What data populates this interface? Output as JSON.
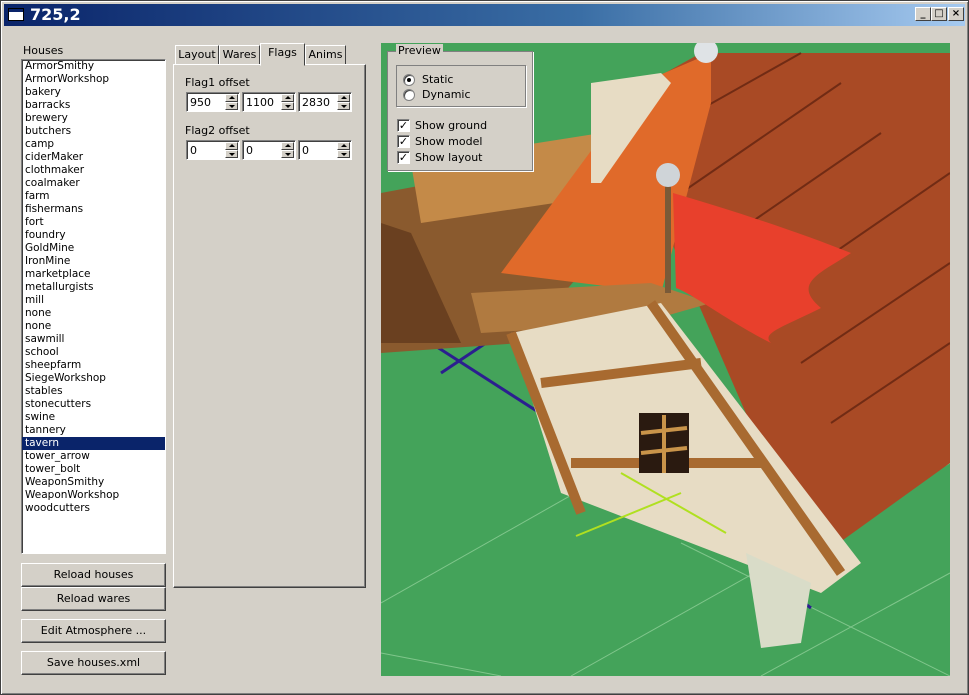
{
  "window": {
    "title": "725,2"
  },
  "houses": {
    "label": "Houses",
    "items": [
      "ArmorSmithy",
      "ArmorWorkshop",
      "bakery",
      "barracks",
      "brewery",
      "butchers",
      "camp",
      "ciderMaker",
      "clothmaker",
      "coalmaker",
      "farm",
      "fishermans",
      "fort",
      "foundry",
      "GoldMine",
      "IronMine",
      "marketplace",
      "metallurgists",
      "mill",
      "none",
      "none",
      "sawmill",
      "school",
      "sheepfarm",
      "SiegeWorkshop",
      "stables",
      "stonecutters",
      "swine",
      "tannery",
      "tavern",
      "tower_arrow",
      "tower_bolt",
      "WeaponSmithy",
      "WeaponWorkshop",
      "woodcutters"
    ],
    "selected_index": 29
  },
  "buttons": {
    "reload_houses": "Reload houses",
    "reload_wares": "Reload wares",
    "edit_atmosphere": "Edit Atmosphere ...",
    "save_houses": "Save houses.xml"
  },
  "tabs": [
    {
      "label": "Layout",
      "active": false
    },
    {
      "label": "Wares",
      "active": false
    },
    {
      "label": "Flags",
      "active": true
    },
    {
      "label": "Anims",
      "active": false
    }
  ],
  "flags": {
    "flag1_label": "Flag1 offset",
    "flag1_values": [
      "950",
      "1100",
      "2830"
    ],
    "flag2_label": "Flag2 offset",
    "flag2_values": [
      "0",
      "0",
      "0"
    ]
  },
  "preview": {
    "title": "Preview",
    "mode_static": "Static",
    "mode_dynamic": "Dynamic",
    "selected_mode": "Static",
    "show_ground": "Show ground",
    "show_model": "Show model",
    "show_layout": "Show layout",
    "show_ground_checked": true,
    "show_model_checked": true,
    "show_layout_checked": true
  },
  "colors": {
    "ground": "#44a35a",
    "roof": "#d9531f",
    "flag": "#e8402c",
    "layout_outline": "#2b1f8f",
    "selection": "#0a246a"
  }
}
